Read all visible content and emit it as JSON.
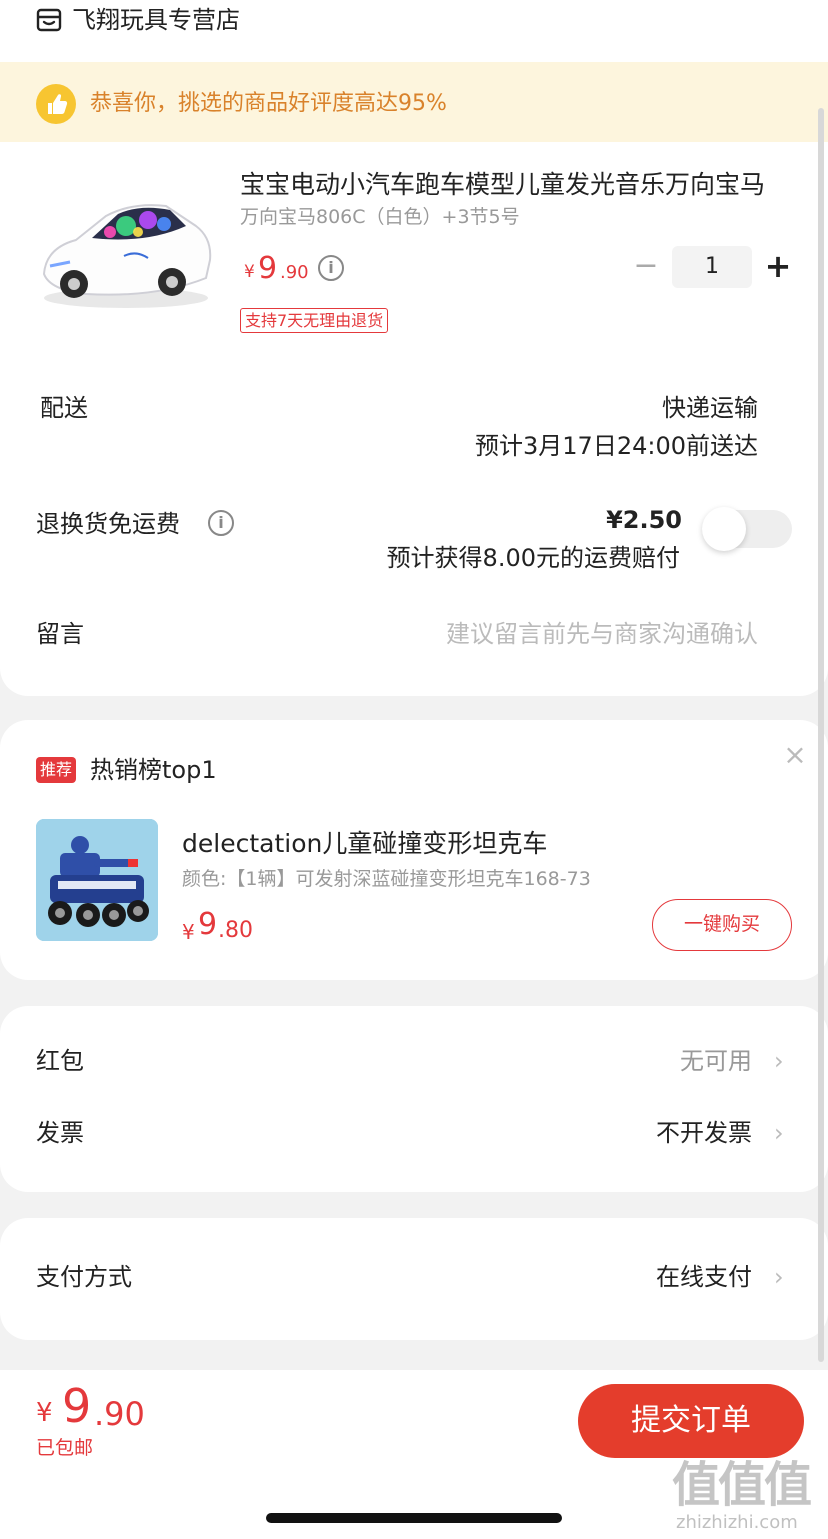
{
  "store": {
    "name": "飞翔玩具专营店",
    "icon": "store-icon"
  },
  "banner": {
    "text": "恭喜你，挑选的商品好评度高达95%",
    "icon": "thumbs-up-icon"
  },
  "product": {
    "title": "宝宝电动小汽车跑车模型儿童发光音乐万向宝马",
    "spec": "万向宝马806C（白色）+3节5号",
    "price_symbol": "¥",
    "price_int": "9",
    "price_dec": ".90",
    "info_icon": "i",
    "badge": "支持7天无理由退货",
    "quantity": "1",
    "minus": "−",
    "plus": "+"
  },
  "delivery": {
    "label": "配送",
    "method": "快递运输",
    "eta": "预计3月17日24:00前送达"
  },
  "freight_insurance": {
    "label": "退换货免运费",
    "info_icon": "i",
    "price": "¥2.50",
    "desc": "预计获得8.00元的运费赔付",
    "enabled": false
  },
  "note": {
    "label": "留言",
    "placeholder": "建议留言前先与商家沟通确认"
  },
  "recommend": {
    "tag": "推荐",
    "title": "热销榜top1",
    "close": "×",
    "name": "delectation儿童碰撞变形坦克车",
    "spec": "颜色:【1辆】可发射深蓝碰撞变形坦克车168-73",
    "price_symbol": "¥",
    "price_int": "9",
    "price_dec": ".80",
    "buy_label": "一键购买"
  },
  "options": {
    "red_packet": {
      "label": "红包",
      "value": "无可用"
    },
    "invoice": {
      "label": "发票",
      "value": "不开发票"
    },
    "payment": {
      "label": "支付方式",
      "value": "在线支付"
    },
    "chevron": "›"
  },
  "footer": {
    "total_symbol": "¥",
    "total_int": "9",
    "total_dec": ".90",
    "shipping": "已包邮",
    "submit": "提交订单"
  },
  "watermark": {
    "text": "值值值",
    "url": "zhizhizhi.com"
  },
  "colors": {
    "accent": "#e4393c",
    "banner_bg": "#fdf5dd",
    "banner_text": "#d9822b",
    "page_bg": "#f2f2f2"
  }
}
